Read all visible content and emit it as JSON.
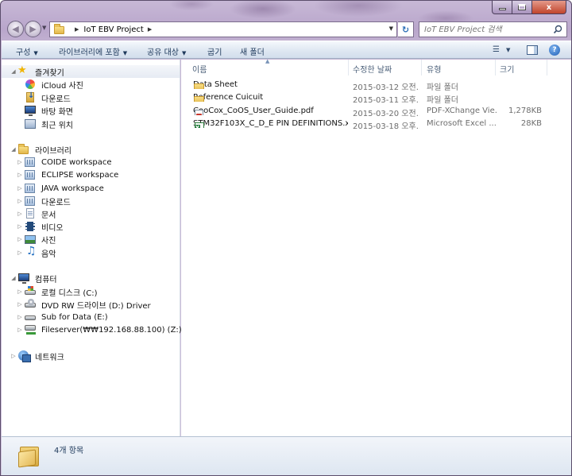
{
  "window": {
    "caption_buttons": {
      "minimize_icon": "minimize-icon",
      "maximize_icon": "maximize-icon",
      "close_icon": "close-icon",
      "close_glyph": "x"
    }
  },
  "nav": {
    "back_icon": "back-arrow-icon",
    "forward_icon": "forward-arrow-icon"
  },
  "address": {
    "breadcrumb": [
      "IoT EBV Project"
    ]
  },
  "search": {
    "placeholder": "IoT EBV Project 검색"
  },
  "toolbar": {
    "items": [
      "구성",
      "라이브러리에 포함",
      "공유 대상",
      "굽기",
      "새 폴더"
    ]
  },
  "sidebar": {
    "favorites": {
      "label": "즐겨찾기",
      "items": [
        "iCloud 사진",
        "다운로드",
        "바탕 화면",
        "최근 위치"
      ]
    },
    "libraries": {
      "label": "라이브러리",
      "items": [
        "COIDE workspace",
        "ECLIPSE workspace",
        "JAVA workspace",
        "다운로드",
        "문서",
        "비디오",
        "사진",
        "음악"
      ]
    },
    "computer": {
      "label": "컴퓨터",
      "items": [
        "로컬 디스크 (C:)",
        "DVD RW 드라이브 (D:) Driver",
        "Sub for Data (E:)",
        "Fileserver(₩₩192.168.88.100) (Z:)"
      ]
    },
    "network": {
      "label": "네트워크"
    }
  },
  "files": {
    "columns": [
      "이름",
      "수정한 날짜",
      "유형",
      "크기"
    ],
    "rows": [
      {
        "name": "Data Sheet",
        "date": "2015-03-12 오전...",
        "type": "파일 폴더",
        "size": "",
        "icon": "folder-icon"
      },
      {
        "name": "Reference Cuicuit",
        "date": "2015-03-11 오후...",
        "type": "파일 폴더",
        "size": "",
        "icon": "folder-icon"
      },
      {
        "name": "CooCox_CoOS_User_Guide.pdf",
        "date": "2015-03-20 오전...",
        "type": "PDF-XChange Vie...",
        "size": "1,278KB",
        "icon": "pdf-icon"
      },
      {
        "name": "STM32F103X_C_D_E PIN DEFINITIONS.x...",
        "date": "2015-03-18 오후...",
        "type": "Microsoft Excel ...",
        "size": "28KB",
        "icon": "excel-icon"
      }
    ]
  },
  "status": {
    "text": "4개 항목"
  }
}
